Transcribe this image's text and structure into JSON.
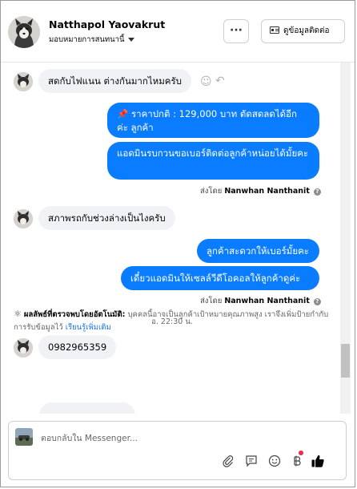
{
  "header": {
    "name": "Natthapol Yaovakrut",
    "subtitle": "มอบหมายการสนทนานี้",
    "more_label": "···",
    "contact_label": "ดูข้อมูลติดต่อ"
  },
  "messages": {
    "in_1": "สดกับไฟแนน ต่างกันมากไหมครับ",
    "out_1": "📌 ราคาปกติ : 129,000 บาท ตัดสดลดได้อีก ค่ะ ลูกค้า",
    "out_2": "แอดมินรบกวนขอเบอร์ติดต่อลูกค้าหน่อยได้มั้ยคะ",
    "sent_by_1_prefix": "ส่งโดย",
    "sent_by_1_name": "Nanwhan Nanthanit",
    "in_2": "สภาพรถกับช่วงล่างเป็นไงครับ",
    "out_3": "ลูกค้าสะดวกให้เบอร์มั้ยคะ",
    "out_4": "เดี๋ยวแอดมินให้เซลล์วีดีโอคอลให้ลูกค้าดูค่ะ",
    "sent_by_2_prefix": "ส่งโดย",
    "sent_by_2_name": "Nanwhan Nanthanit",
    "time_divider": "อ. 22:30 น.",
    "in_3": "0982965359",
    "notice_title": "ผลลัพธ์ที่ตรวจพบโดยอัตโนมัติ:",
    "notice_body": "บุคคลนี้อาจเป็นลูกค้าเป้าหมายคุณภาพสูง เราจึงเพิ่มป้ายกำกับการรับข้อมูลไว้",
    "notice_link": "เรียนรู้เพิ่มเติม"
  },
  "composer": {
    "placeholder": "ตอบกลับใน Messenger..."
  },
  "icons": [
    "attach-icon",
    "saved-reply-icon",
    "emoji-icon",
    "payment-icon",
    "like-icon",
    "more-icon",
    "contact-card-icon",
    "reaction-icon",
    "reply-icon",
    "info-icon",
    "automation-icon"
  ],
  "colors": {
    "outgoing_bubble": "#0a7cff",
    "incoming_bubble": "#f0f2f5",
    "link": "#1b74e4",
    "like": "#050505"
  }
}
